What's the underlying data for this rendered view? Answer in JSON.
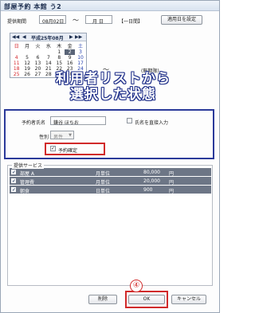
{
  "title": "部屋予約 本館 う2",
  "period": {
    "label": "提供期間",
    "start_date": "08月02日",
    "separator": "〜",
    "end_placeholder": "月 日",
    "one_period": "【一日間】",
    "apply_button": "適用日を設定"
  },
  "calendar": {
    "title": "平成25年08月",
    "weekdays": [
      "日",
      "月",
      "火",
      "水",
      "木",
      "金",
      "土"
    ],
    "days": [
      "",
      "",
      "",
      "",
      "1",
      "2",
      "3",
      "4",
      "5",
      "6",
      "7",
      "8",
      "9",
      "10",
      "11",
      "12",
      "13",
      "14",
      "15",
      "16",
      "17",
      "18",
      "19",
      "20",
      "21",
      "22",
      "23",
      "24",
      "25",
      "26",
      "27",
      "28",
      "29",
      "30",
      "31"
    ],
    "selected_day": "2"
  },
  "time_range": {
    "separator": "〜",
    "note": "(無期限)"
  },
  "overlay_caption": {
    "line1": "利用者リストから",
    "line2": "選択した状態"
  },
  "reserver": {
    "name_label": "予約者氏名",
    "name_value": "鎌谷 ほちお",
    "direct_input_label": "氏名を直接入力",
    "gender_label": "性別",
    "gender_value": "男性",
    "confirm_label": "予約確定",
    "confirm_checked": true
  },
  "services": {
    "group_label": "提供サービス",
    "rows": [
      {
        "name": "部屋 A",
        "unit": "月単位",
        "price": "80,000",
        "currency": "円",
        "checked": true
      },
      {
        "name": "管理費",
        "unit": "月単位",
        "price": "20,000",
        "currency": "円",
        "checked": true
      },
      {
        "name": "朝食",
        "unit": "日単位",
        "price": "900",
        "currency": "円",
        "checked": true
      }
    ]
  },
  "buttons": {
    "delete": "削除",
    "ok": "OK",
    "cancel": "キャンセル"
  },
  "step_marker": "④",
  "colors": {
    "highlight_blue": "#2b3a9a",
    "highlight_red": "#d12a2a",
    "row_selected": "#6d7686"
  }
}
